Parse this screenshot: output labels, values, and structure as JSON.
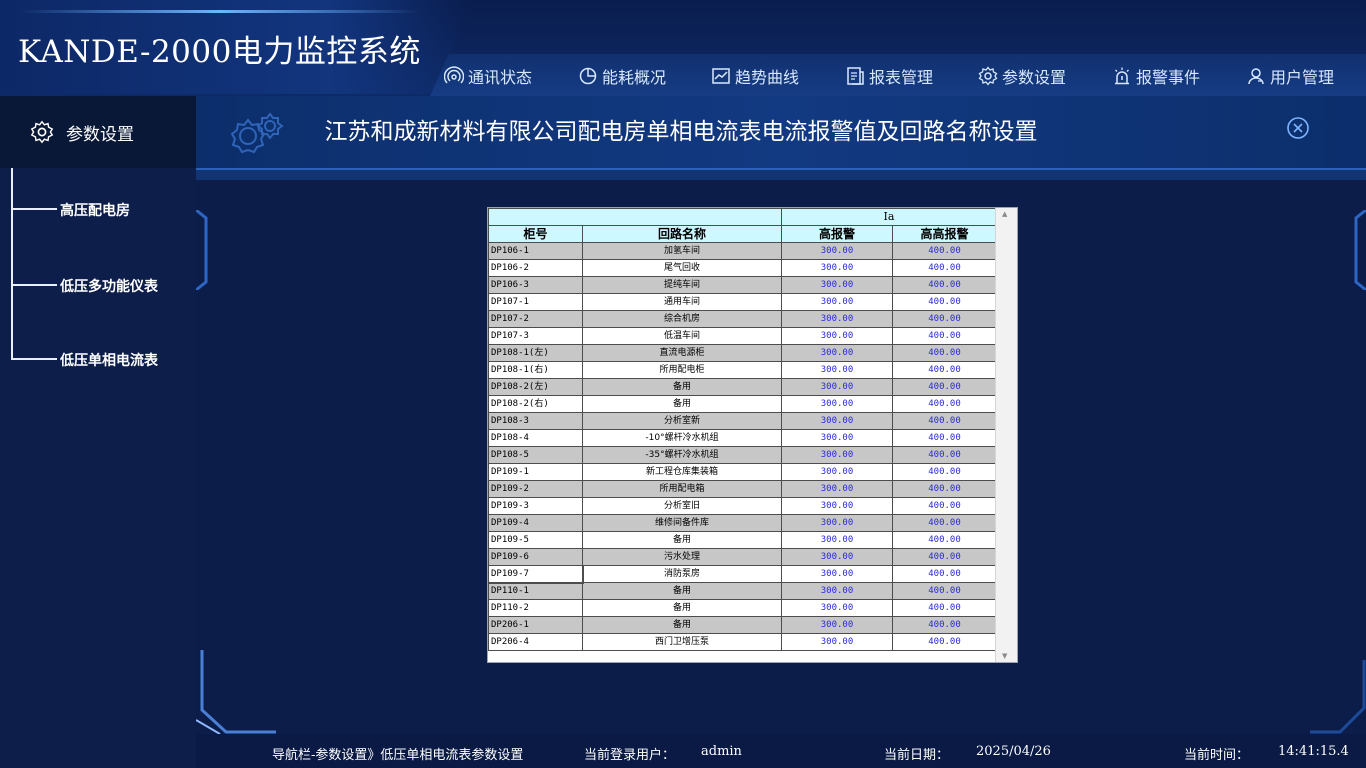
{
  "app": {
    "title": "KANDE-2000电力监控系统"
  },
  "nav": [
    {
      "label": "通讯状态",
      "icon": "signal-icon"
    },
    {
      "label": "能耗概况",
      "icon": "pie-chart-icon"
    },
    {
      "label": "趋势曲线",
      "icon": "trend-icon"
    },
    {
      "label": "报表管理",
      "icon": "report-icon"
    },
    {
      "label": "参数设置",
      "icon": "gear-icon"
    },
    {
      "label": "报警事件",
      "icon": "alarm-icon"
    },
    {
      "label": "用户管理",
      "icon": "user-icon"
    }
  ],
  "sidebar": {
    "title": "参数设置",
    "items": [
      {
        "label": "高压配电房"
      },
      {
        "label": "低压多功能仪表"
      },
      {
        "label": "低压单相电流表"
      }
    ]
  },
  "panel": {
    "title": "江苏和成新材料有限公司配电房单相电流表电流报警值及回路名称设置"
  },
  "table": {
    "group_header": "Ia",
    "columns": [
      "柜号",
      "回路名称",
      "高报警",
      "高高报警"
    ],
    "rows": [
      [
        "DP106-1",
        "加氢车间",
        "300.00",
        "400.00"
      ],
      [
        "DP106-2",
        "尾气回收",
        "300.00",
        "400.00"
      ],
      [
        "DP106-3",
        "提纯车间",
        "300.00",
        "400.00"
      ],
      [
        "DP107-1",
        "通用车间",
        "300.00",
        "400.00"
      ],
      [
        "DP107-2",
        "综合机房",
        "300.00",
        "400.00"
      ],
      [
        "DP107-3",
        "低温车间",
        "300.00",
        "400.00"
      ],
      [
        "DP108-1(左)",
        "直流电源柜",
        "300.00",
        "400.00"
      ],
      [
        "DP108-1(右)",
        "所用配电柜",
        "300.00",
        "400.00"
      ],
      [
        "DP108-2(左)",
        "备用",
        "300.00",
        "400.00"
      ],
      [
        "DP108-2(右)",
        "备用",
        "300.00",
        "400.00"
      ],
      [
        "DP108-3",
        "分析室新",
        "300.00",
        "400.00"
      ],
      [
        "DP108-4",
        "-10°螺杆冷水机组",
        "300.00",
        "400.00"
      ],
      [
        "DP108-5",
        "-35°螺杆冷水机组",
        "300.00",
        "400.00"
      ],
      [
        "DP109-1",
        "新工程仓库集装箱",
        "300.00",
        "400.00"
      ],
      [
        "DP109-2",
        "所用配电箱",
        "300.00",
        "400.00"
      ],
      [
        "DP109-3",
        "分析室旧",
        "300.00",
        "400.00"
      ],
      [
        "DP109-4",
        "维修间备件库",
        "300.00",
        "400.00"
      ],
      [
        "DP109-5",
        "备用",
        "300.00",
        "400.00"
      ],
      [
        "DP109-6",
        "污水处理",
        "300.00",
        "400.00"
      ],
      [
        "DP109-7",
        "消防泵房",
        "300.00",
        "400.00"
      ],
      [
        "DP110-1",
        "备用",
        "300.00",
        "400.00"
      ],
      [
        "DP110-2",
        "备用",
        "300.00",
        "400.00"
      ],
      [
        "DP206-1",
        "备用",
        "300.00",
        "400.00"
      ],
      [
        "DP206-4",
        "西门卫增压泵",
        "300.00",
        "400.00"
      ]
    ]
  },
  "footer": {
    "breadcrumb": "导航栏-参数设置》低压单相电流表参数设置",
    "user_label": "当前登录用户：",
    "user_value": "admin",
    "date_label": "当前日期：",
    "date_value": "2025/04/26",
    "time_label": "当前时间：",
    "time_value": "14:41:15.4"
  },
  "colors": {
    "background": "#0c1d4a",
    "table_header": "#cdf8ff",
    "row_gray": "#c7c7c7",
    "value_text": "#2a2ad8"
  }
}
